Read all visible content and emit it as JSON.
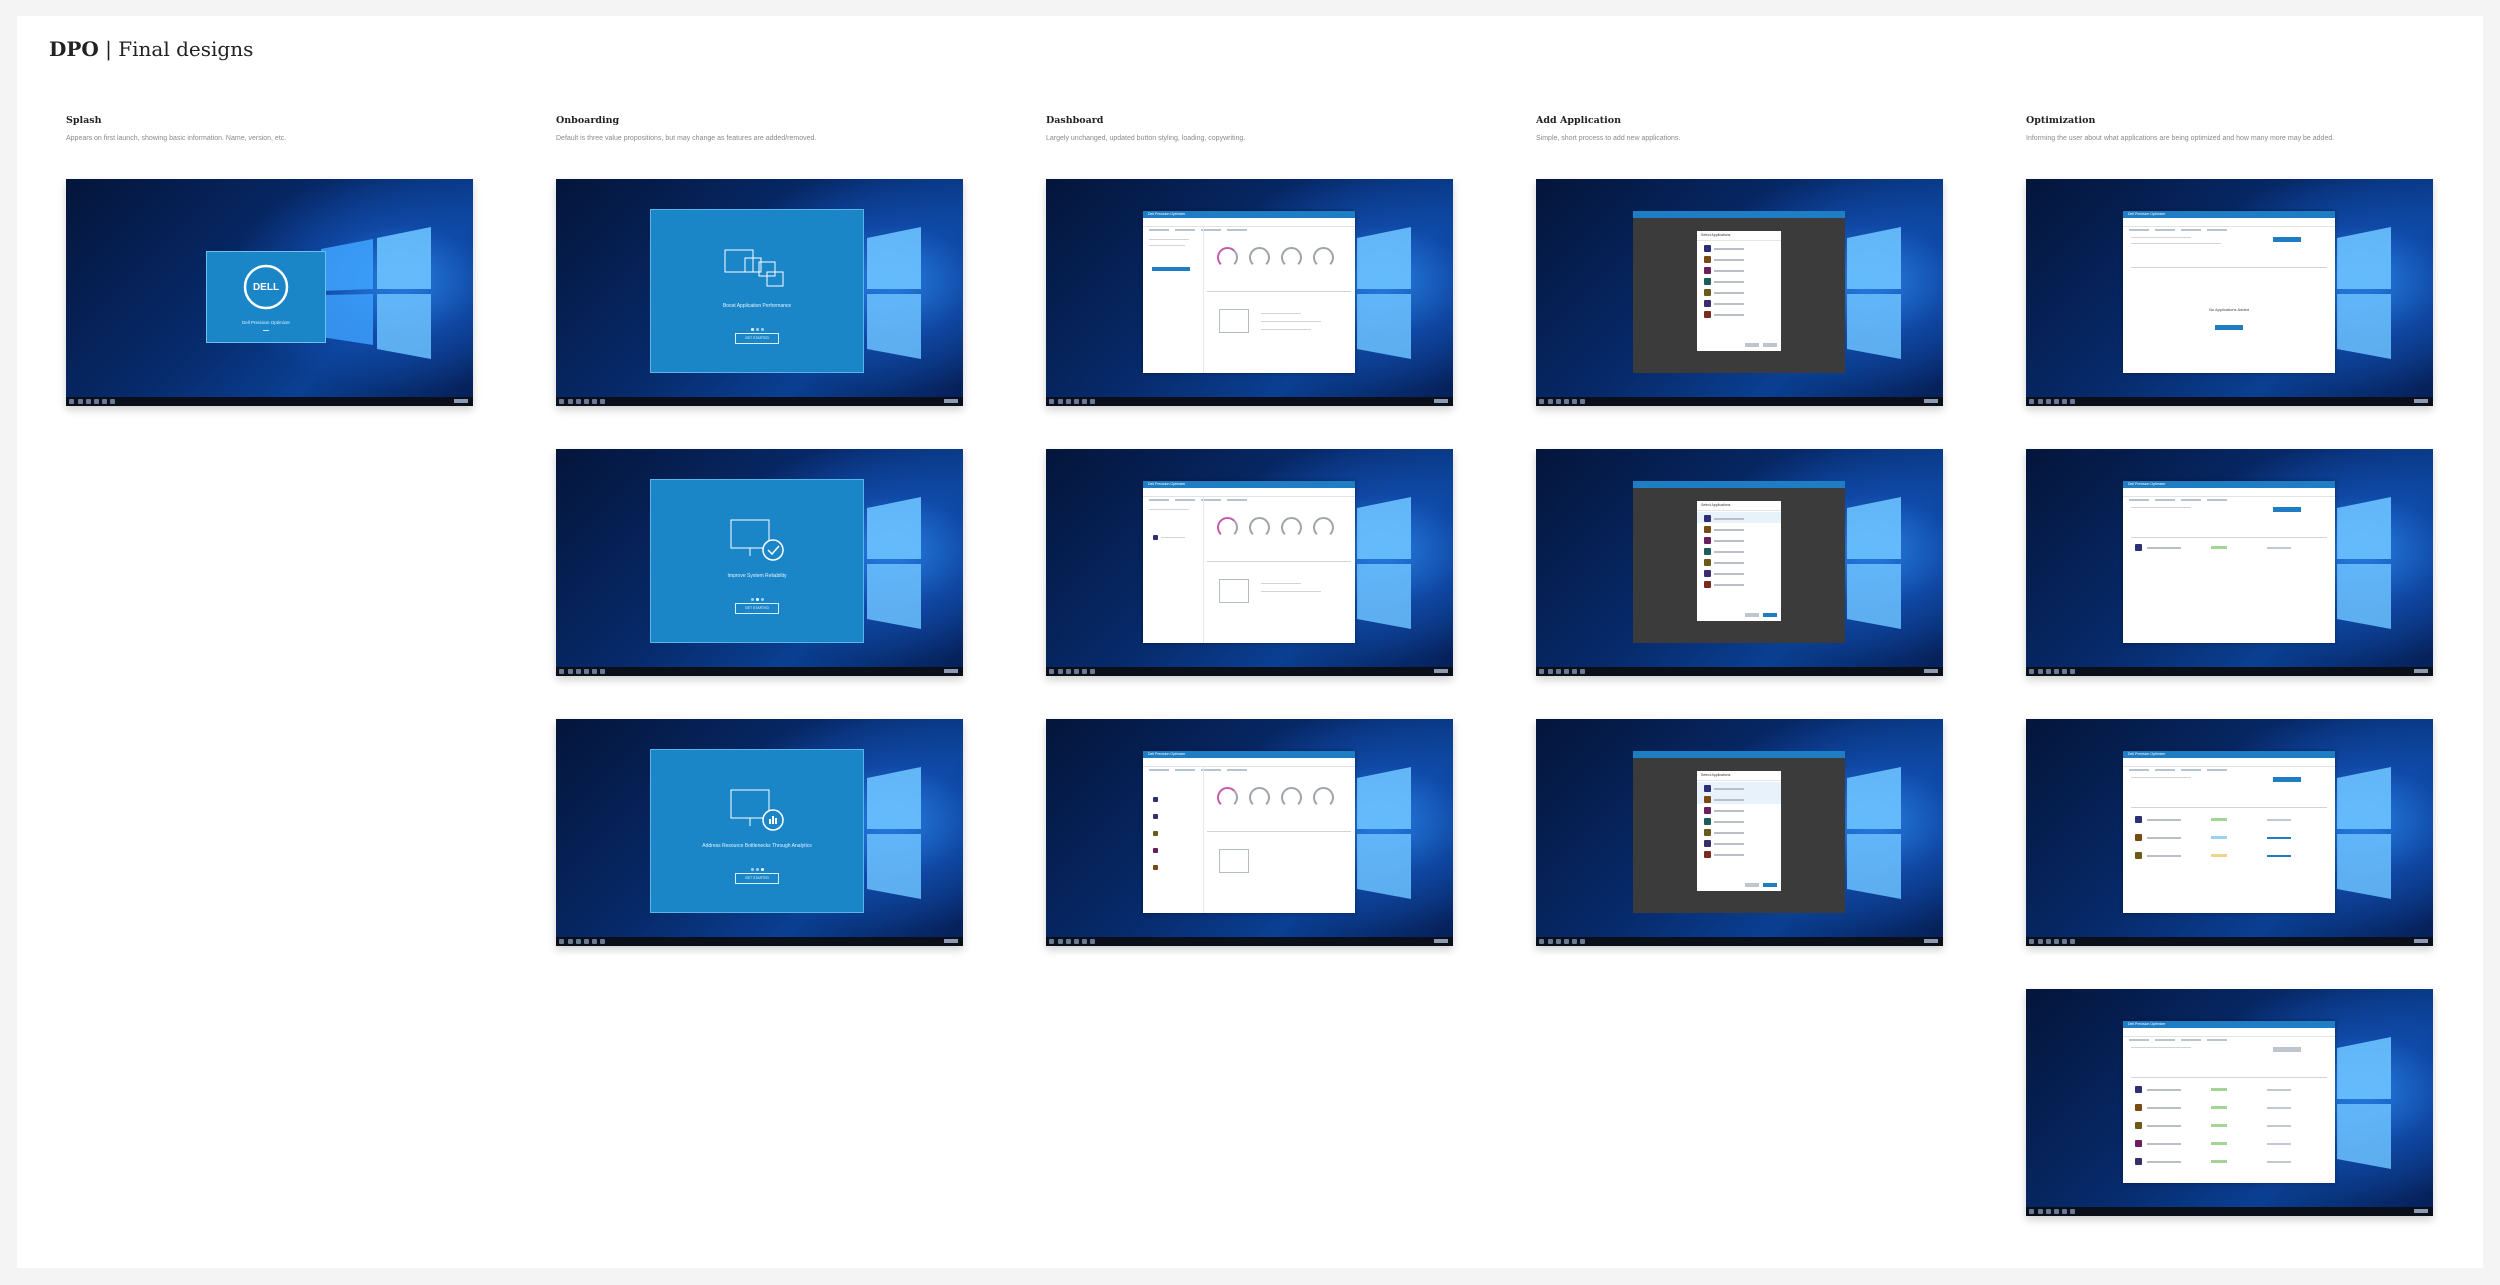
{
  "page": {
    "title_bold": "DPO",
    "title_rest": " | Final designs"
  },
  "columns": [
    {
      "heading": "Splash",
      "description": "Appears on first launch, showing basic information. Name, version, etc."
    },
    {
      "heading": "Onboarding",
      "description": "Default is three value propositions, but may change as features are added/removed."
    },
    {
      "heading": "Dashboard",
      "description": "Largely unchanged, updated button styling, loading, copywriting."
    },
    {
      "heading": "Add Application",
      "description": "Simple, short process to add new applications."
    },
    {
      "heading": "Optimization",
      "description": "Informing the user about what applications are being optimized and how many more may be added."
    }
  ],
  "splash": {
    "logo_text": "DELL",
    "product_name": "Dell Precision Optimizer"
  },
  "onboarding": [
    {
      "caption": "Boost Application Performance",
      "button": "GET STARTED"
    },
    {
      "caption": "Improve System Reliability",
      "button": "GET STARTED"
    },
    {
      "caption": "Address Resource Bottlenecks Through Analytics",
      "button": "GET STARTED"
    }
  ],
  "dashboard": {
    "window_title": "Dell Precision Optimizer",
    "gauges": [
      "CPU",
      "Graphics",
      "Storage",
      "Memory"
    ]
  },
  "add_application": {
    "window_title": "Dell Precision Optimizer",
    "dialog_title": "Select Applications"
  },
  "optimization": {
    "window_title": "Dell Precision Optimizer",
    "empty_title": "No Applications Added"
  },
  "colors": {
    "accent": "#1f7dc3",
    "onboarding_panel": "#1a86c8",
    "desktop_dark": "#04153a",
    "desktop_light": "#2d8ae8"
  }
}
